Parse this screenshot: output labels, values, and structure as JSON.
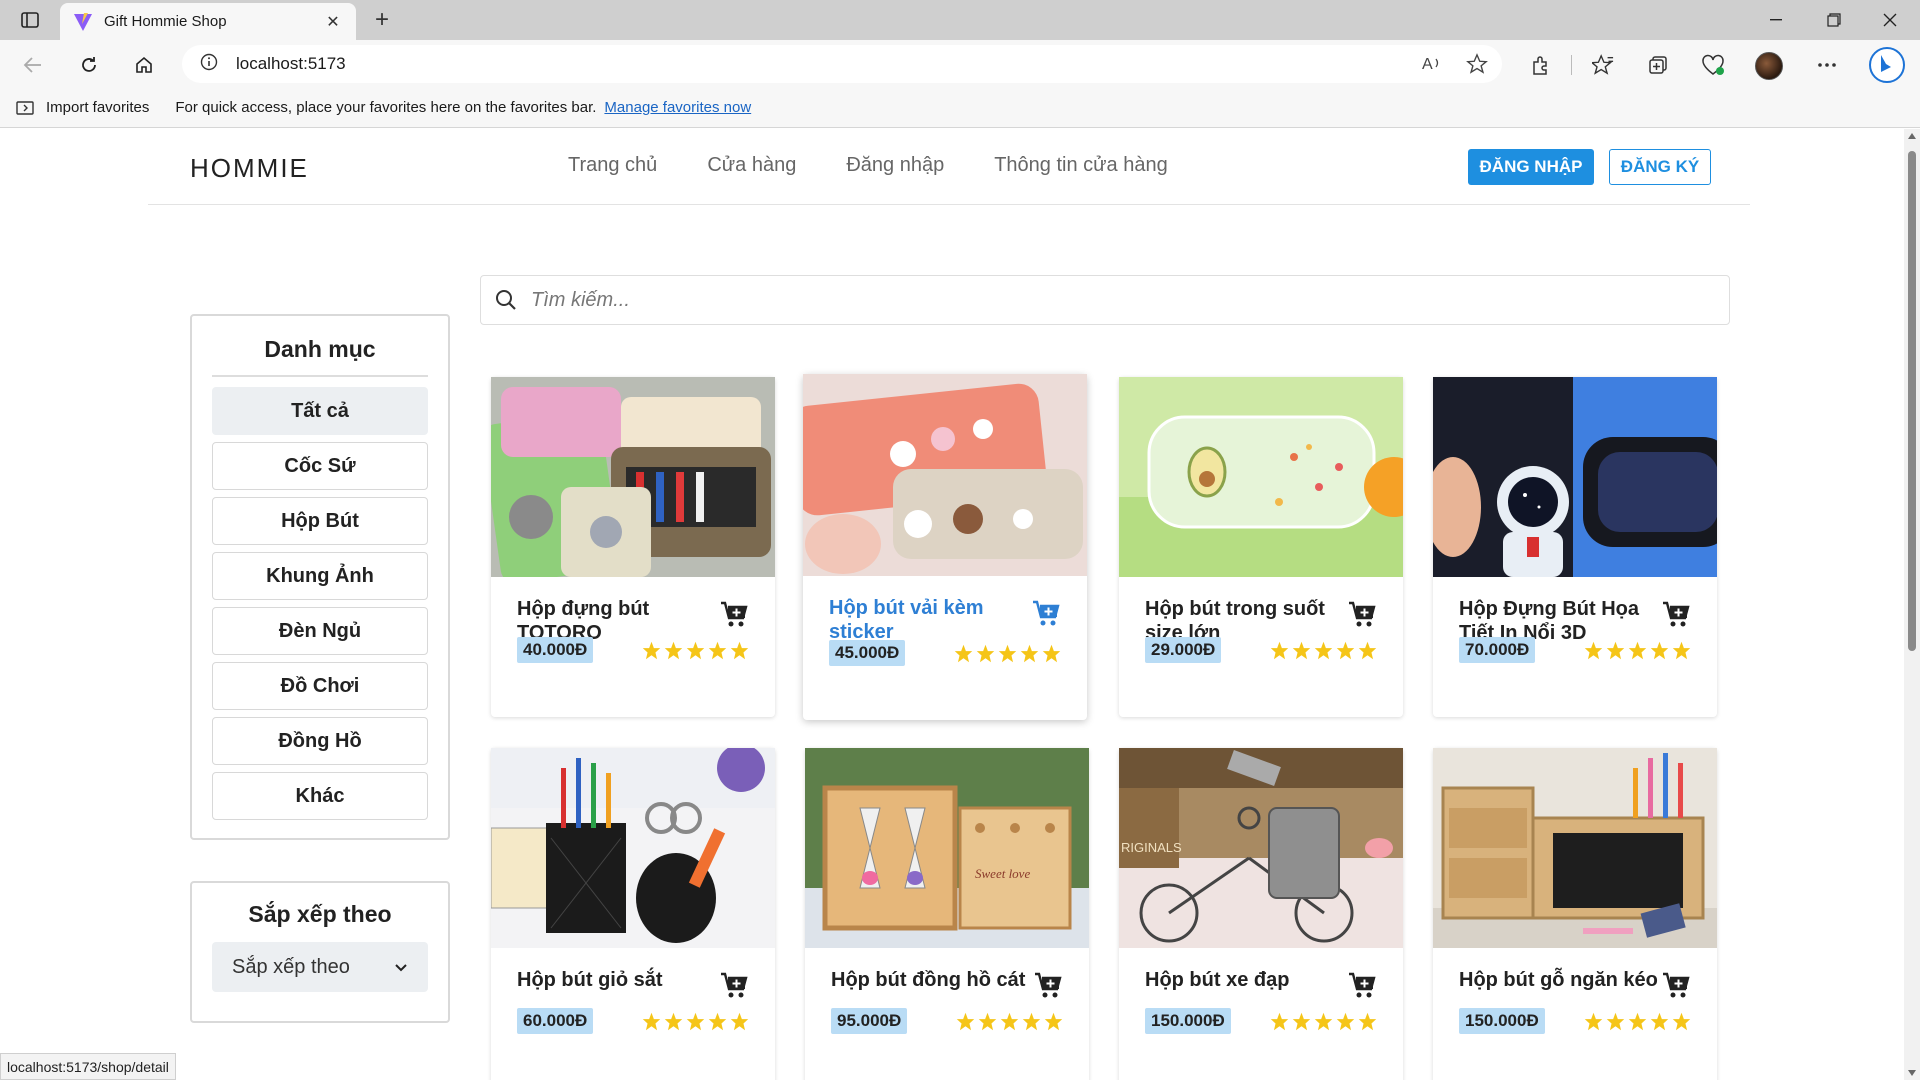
{
  "browser": {
    "tab_title": "Gift Hommie Shop",
    "url": "localhost:5173",
    "favorites_import": "Import favorites",
    "favorites_message": "For quick access, place your favorites here on the favorites bar.",
    "favorites_link": "Manage favorites now",
    "status_url": "localhost:5173/shop/detail"
  },
  "header": {
    "logo": "HOMMIE",
    "nav": [
      "Trang chủ",
      "Cửa hàng",
      "Đăng nhập",
      "Thông tin cửa hàng"
    ],
    "login_button": "ĐĂNG NHẬP",
    "register_button": "ĐĂNG KÝ"
  },
  "search": {
    "placeholder": "Tìm kiếm..."
  },
  "categories": {
    "title": "Danh mục",
    "items": [
      "Tất cả",
      "Cốc Sứ",
      "Hộp Bút",
      "Khung Ảnh",
      "Đèn Ngủ",
      "Đồ Chơi",
      "Đồng Hồ",
      "Khác"
    ],
    "active": "Tất cả"
  },
  "sort": {
    "title": "Sắp xếp theo",
    "selected": "Sắp xếp theo"
  },
  "products": [
    {
      "name": "Hộp đựng bút TOTORO",
      "price": "40.000Đ",
      "rating": 5
    },
    {
      "name": "Hộp bút vải kèm sticker",
      "price": "45.000Đ",
      "rating": 5
    },
    {
      "name": "Hộp bút trong suốt size lớn",
      "price": "29.000Đ",
      "rating": 5
    },
    {
      "name": "Hộp Đựng Bút Họa Tiết In Nổi 3D",
      "price": "70.000Đ",
      "rating": 5
    },
    {
      "name": "Hộp bút giỏ sắt",
      "price": "60.000Đ",
      "rating": 5
    },
    {
      "name": "Hộp bút đồng hồ cát",
      "price": "95.000Đ",
      "rating": 5
    },
    {
      "name": "Hộp bút xe đạp",
      "price": "150.000Đ",
      "rating": 5
    },
    {
      "name": "Hộp bút gỗ ngăn kéo",
      "price": "150.000Đ",
      "rating": 5
    }
  ],
  "colors": {
    "accent": "#1e8fe0",
    "price_bg": "#b9dcf5",
    "star": "#f5c518",
    "hover_link": "#2e7fd4"
  }
}
